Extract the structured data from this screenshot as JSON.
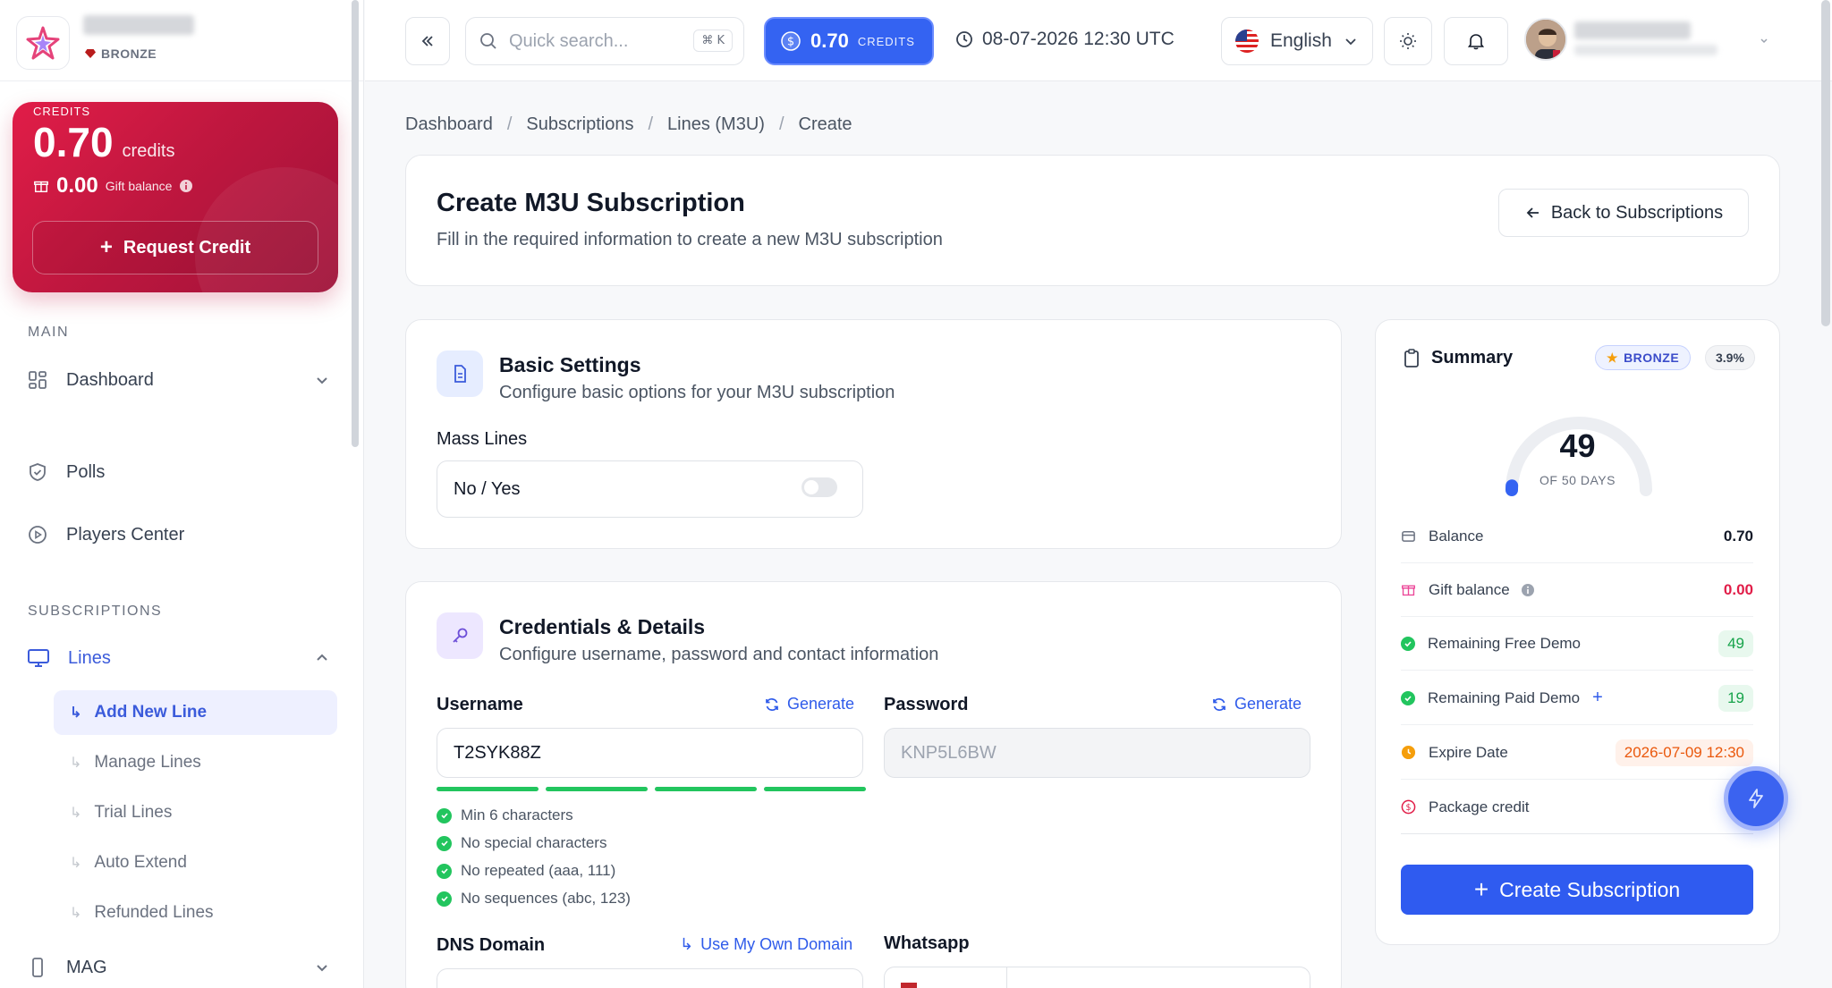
{
  "sidebar": {
    "tier": "BRONZE",
    "credit_card": {
      "label": "CREDITS",
      "amount": "0.70",
      "unit": "credits",
      "gift_amount": "0.00",
      "gift_label": "Gift balance",
      "request_label": "Request Credit"
    },
    "sections": {
      "main": "MAIN",
      "subscriptions": "SUBSCRIPTIONS"
    },
    "items": {
      "dashboard": "Dashboard",
      "polls": "Polls",
      "players_center": "Players Center",
      "lines": "Lines",
      "mag": "MAG"
    },
    "lines_sub": [
      "Add New Line",
      "Manage Lines",
      "Trial Lines",
      "Auto Extend",
      "Refunded Lines"
    ]
  },
  "topbar": {
    "search_placeholder": "Quick search...",
    "search_shortcut": "⌘ K",
    "credits_value": "0.70",
    "credits_label": "CREDITS",
    "datetime": "08-07-2026 12:30 UTC",
    "language": "English"
  },
  "breadcrumb": [
    "Dashboard",
    "Subscriptions",
    "Lines (M3U)",
    "Create"
  ],
  "header": {
    "title": "Create M3U Subscription",
    "subtitle": "Fill in the required information to create a new M3U subscription",
    "back_label": "Back to Subscriptions"
  },
  "basic": {
    "title": "Basic Settings",
    "desc": "Configure basic options for your M3U subscription",
    "mass_lines_label": "Mass Lines",
    "mass_lines_value": "No / Yes"
  },
  "credentials": {
    "title": "Credentials & Details",
    "desc": "Configure username, password and contact information",
    "username_label": "Username",
    "username_value": "T2SYK88Z",
    "password_label": "Password",
    "password_value": "KNP5L6BW",
    "generate": "Generate",
    "rules": [
      "Min 6 characters",
      "No special characters",
      "No repeated (aaa, 111)",
      "No sequences (abc, 123)"
    ],
    "dns_label": "DNS Domain",
    "own_domain": "Use My Own Domain",
    "whatsapp_label": "Whatsapp"
  },
  "summary": {
    "title": "Summary",
    "tier": "BRONZE",
    "pct": "3.9%",
    "gauge_value": "49",
    "gauge_sub": "OF 50 DAYS",
    "gauge_fraction": 0.02,
    "rows": {
      "balance_label": "Balance",
      "balance_value": "0.70",
      "gift_label": "Gift balance",
      "gift_value": "0.00",
      "free_demo_label": "Remaining Free Demo",
      "free_demo_value": "49",
      "paid_demo_label": "Remaining Paid Demo",
      "paid_demo_value": "19",
      "expire_label": "Expire Date",
      "expire_value": "2026-07-09 12:30",
      "package_label": "Package credit"
    },
    "create_label": "Create Subscription"
  },
  "colors": {
    "accent": "#2f5bf0",
    "credit_card": "#d1184a",
    "success": "#22c55e",
    "danger": "#e11d48",
    "warning": "#f59e0b"
  }
}
